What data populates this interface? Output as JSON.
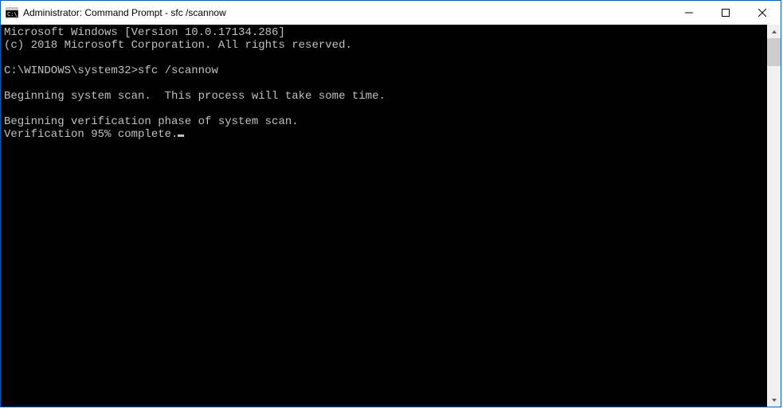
{
  "titlebar": {
    "title": "Administrator: Command Prompt - sfc  /scannow"
  },
  "console": {
    "line1": "Microsoft Windows [Version 10.0.17134.286]",
    "line2": "(c) 2018 Microsoft Corporation. All rights reserved.",
    "blank1": " ",
    "prompt_path": "C:\\WINDOWS\\system32>",
    "prompt_cmd": "sfc /scannow",
    "blank2": " ",
    "line3": "Beginning system scan.  This process will take some time.",
    "blank3": " ",
    "line4": "Beginning verification phase of system scan.",
    "line5": "Verification 95% complete."
  }
}
